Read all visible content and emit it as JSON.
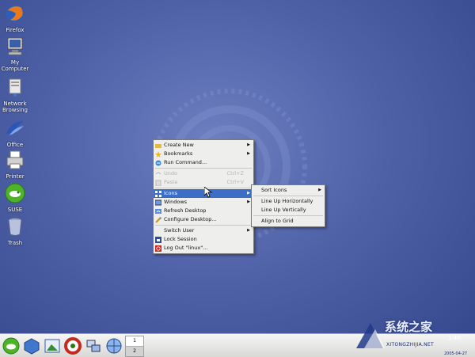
{
  "desktop": {
    "icons": [
      {
        "label": "Firefox",
        "icon": "firefox-icon"
      },
      {
        "label": "My Computer",
        "icon": "computer-icon"
      },
      {
        "label": "Network Browsing",
        "icon": "network-icon"
      },
      {
        "label": "Office",
        "icon": "office-icon"
      },
      {
        "label": "Printer",
        "icon": "printer-icon"
      },
      {
        "label": "SUSE",
        "icon": "suse-icon"
      },
      {
        "label": "Trash",
        "icon": "trash-icon"
      }
    ]
  },
  "context_menu": {
    "items": [
      {
        "label": "Create New",
        "submenu": true
      },
      {
        "label": "Bookmarks",
        "submenu": true
      },
      {
        "label": "Run Command..."
      },
      {
        "label": "Undo",
        "shortcut": "Ctrl+Z",
        "disabled": true
      },
      {
        "label": "Paste",
        "shortcut": "Ctrl+V",
        "disabled": true
      },
      {
        "label": "Icons",
        "submenu": true,
        "active": true
      },
      {
        "label": "Windows",
        "submenu": true
      },
      {
        "label": "Refresh Desktop"
      },
      {
        "label": "Configure Desktop..."
      },
      {
        "label": "Switch User",
        "submenu": true
      },
      {
        "label": "Lock Session"
      },
      {
        "label": "Log Out \"linux\"..."
      }
    ]
  },
  "icons_submenu": {
    "items": [
      {
        "label": "Sort Icons",
        "submenu": true
      },
      {
        "label": "Line Up Horizontally"
      },
      {
        "label": "Line Up Vertically"
      },
      {
        "label": "Align to Grid"
      }
    ]
  },
  "taskbar": {
    "pager": [
      "1",
      "2"
    ],
    "launchers": [
      "suse-menu-icon",
      "package-icon",
      "image-icon",
      "help-icon",
      "network-icon",
      "browser-icon"
    ],
    "clock_time": "1:40",
    "date": "2005-04-27"
  },
  "watermark": {
    "title": "系统之家",
    "subtitle": "XITONGZHIJIA.NET"
  },
  "colors": {
    "menu_highlight": "#3c6ec8",
    "desktop_blue": "#4f62a8"
  }
}
